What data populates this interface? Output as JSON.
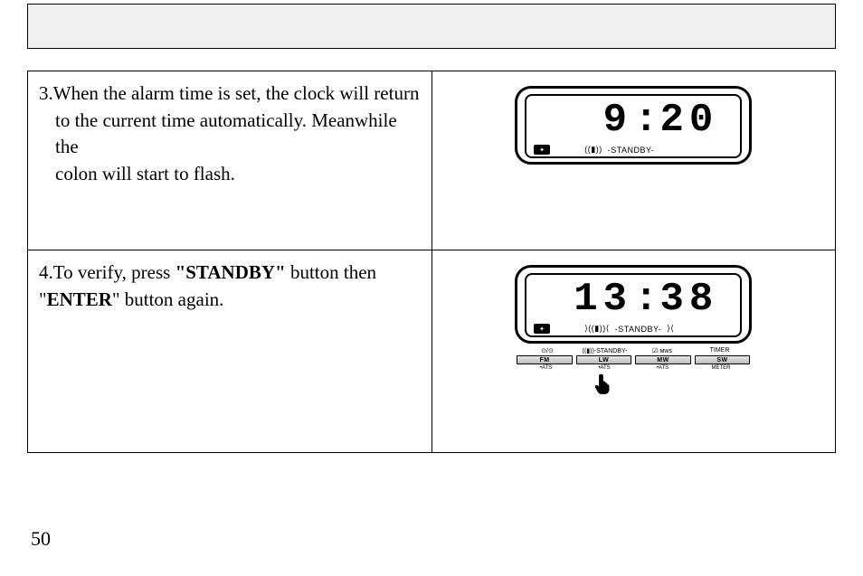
{
  "page_number": "50",
  "rows": [
    {
      "step_number": "3.",
      "text_lines": [
        "When the alarm time is set, the clock will return",
        "to the current time automatically. Meanwhile the",
        "colon will start to flash."
      ],
      "lcd": {
        "digits_before_colon": "9",
        "colon": ":",
        "digits_after_colon": "20",
        "status_label": "-STANDBY-"
      }
    },
    {
      "step_number": "4.",
      "fragments": {
        "t1": "To verify, press  ",
        "q1": "\"",
        "b1": "STANDBY",
        "q2": "\"",
        "t2": "  button then",
        "q3": "\"",
        "b2": "ENTER",
        "q4": "\"",
        "t3": "  button again."
      },
      "lcd": {
        "digits_before_colon": "13",
        "colon": ":",
        "digits_after_colon": "38",
        "status_label": "-STANDBY-"
      },
      "button_bar": {
        "top_labels": [
          "⊙/⊙",
          "((▮))-STANDBY-",
          "☑·ᴍᴡs",
          "TIMER"
        ],
        "buttons": [
          "FM",
          "LW",
          "MW",
          "SW"
        ],
        "sub_labels": [
          "•ATS",
          "•ATS",
          "•ATS",
          "METER"
        ]
      }
    }
  ]
}
